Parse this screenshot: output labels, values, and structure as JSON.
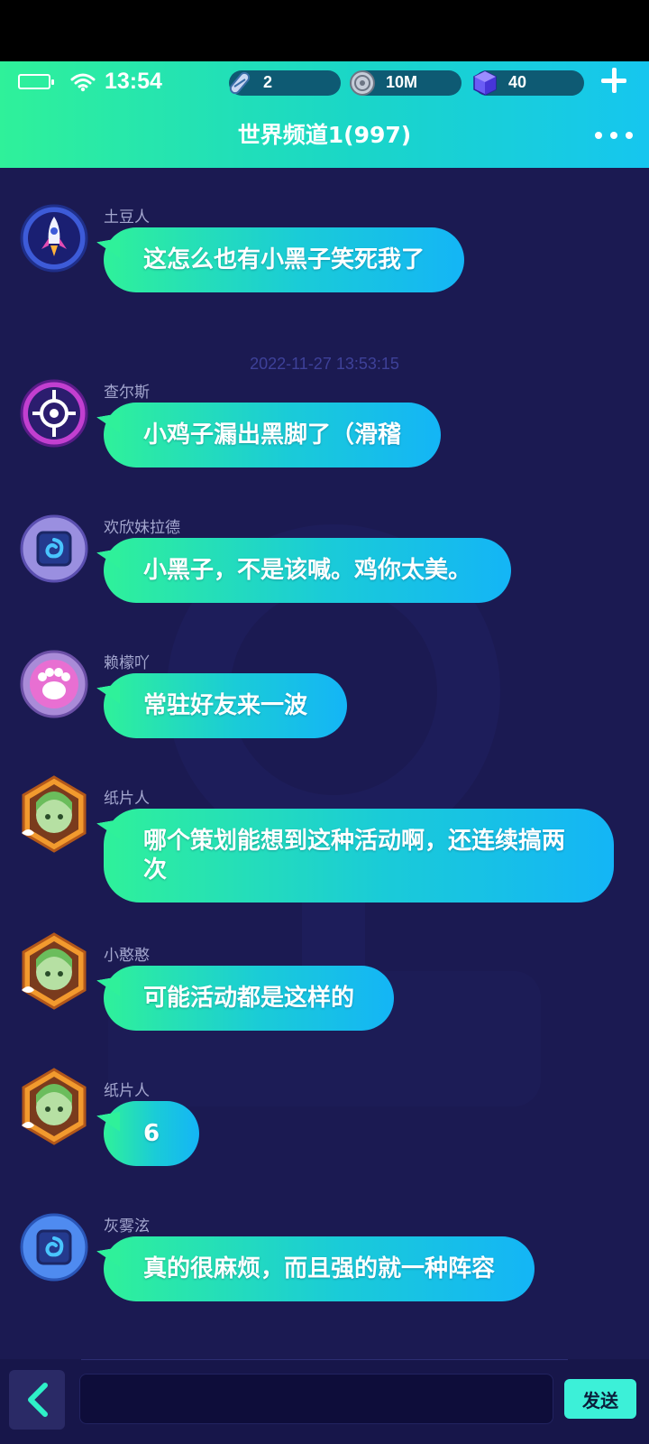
{
  "status_bar": {
    "time": "13:54",
    "battery_icon": "battery-icon",
    "wifi_icon": "wifi-icon"
  },
  "resources": [
    {
      "icon": "skateboard-icon",
      "value": "2"
    },
    {
      "icon": "coin-icon",
      "value": "10M"
    },
    {
      "icon": "gem-cube-icon",
      "value": "40"
    }
  ],
  "header": {
    "channel_title": "世界频道1(997)",
    "more_icon": "more-icon",
    "add_icon": "plus-icon"
  },
  "timestamp": "2022-11-27 13:53:15",
  "messages": [
    {
      "user": "土豆人",
      "text": "这怎么也有小黑子笑死我了",
      "avatar": "rocket-avatar"
    },
    {
      "user": "查尔斯",
      "text": "小鸡子漏出黑脚了（滑稽",
      "avatar": "emblem-avatar"
    },
    {
      "user": "欢欣妹拉德",
      "text": "小黑子，不是该喊。鸡你太美。",
      "avatar": "swirl-avatar"
    },
    {
      "user": "赖檬吖",
      "text": "常驻好友来一波",
      "avatar": "paw-avatar"
    },
    {
      "user": "纸片人",
      "text": "哪个策划能想到这种活动啊，还连续搞两次",
      "avatar": "anime-girl-avatar"
    },
    {
      "user": "小憨憨",
      "text": "可能活动都是这样的",
      "avatar": "anime-girl-avatar"
    },
    {
      "user": "纸片人",
      "text": "6",
      "avatar": "anime-girl-avatar"
    },
    {
      "user": "灰雾泫",
      "text": "真的很麻烦，而且强的就一种阵容",
      "avatar": "swirl-avatar"
    }
  ],
  "input": {
    "value": "",
    "placeholder": ""
  },
  "buttons": {
    "send": "发送",
    "back_icon": "chevron-left-icon"
  },
  "colors": {
    "accent_gradient_start": "#2ff19a",
    "accent_gradient_end": "#14b5f6",
    "background": "#1b1a52"
  }
}
